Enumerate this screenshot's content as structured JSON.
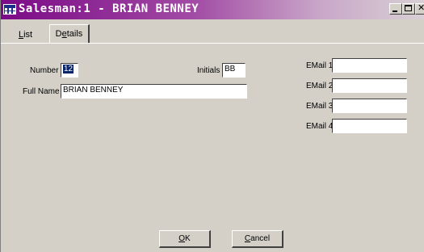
{
  "window": {
    "title": "Salesman:1 - BRIAN BENNEY",
    "icon": "grid-app-icon"
  },
  "titlebar_buttons": {
    "minimize": "minimize-icon",
    "maximize": "maximize-icon",
    "close": "close-icon"
  },
  "tabs": [
    {
      "label": "List",
      "accel": "L",
      "rest": "ist",
      "active": false
    },
    {
      "label": "Details",
      "pre": "D",
      "accel": "e",
      "rest": "tails",
      "active": true
    }
  ],
  "form": {
    "number_label": "Number",
    "number_value": "12",
    "initials_label": "Initials",
    "initials_value": "BB",
    "fullname_label": "Full Name",
    "fullname_value": "BRIAN BENNEY",
    "email1_label": "EMail 1",
    "email1_value": "",
    "email2_label": "EMail 2",
    "email2_value": "",
    "email3_label": "EMail 3",
    "email3_value": "",
    "email4_label": "EMail 4",
    "email4_value": ""
  },
  "buttons": {
    "ok": {
      "label": "OK",
      "accel": "O",
      "rest": "K"
    },
    "cancel": {
      "label": "Cancel",
      "accel": "C",
      "rest": "ancel"
    }
  }
}
